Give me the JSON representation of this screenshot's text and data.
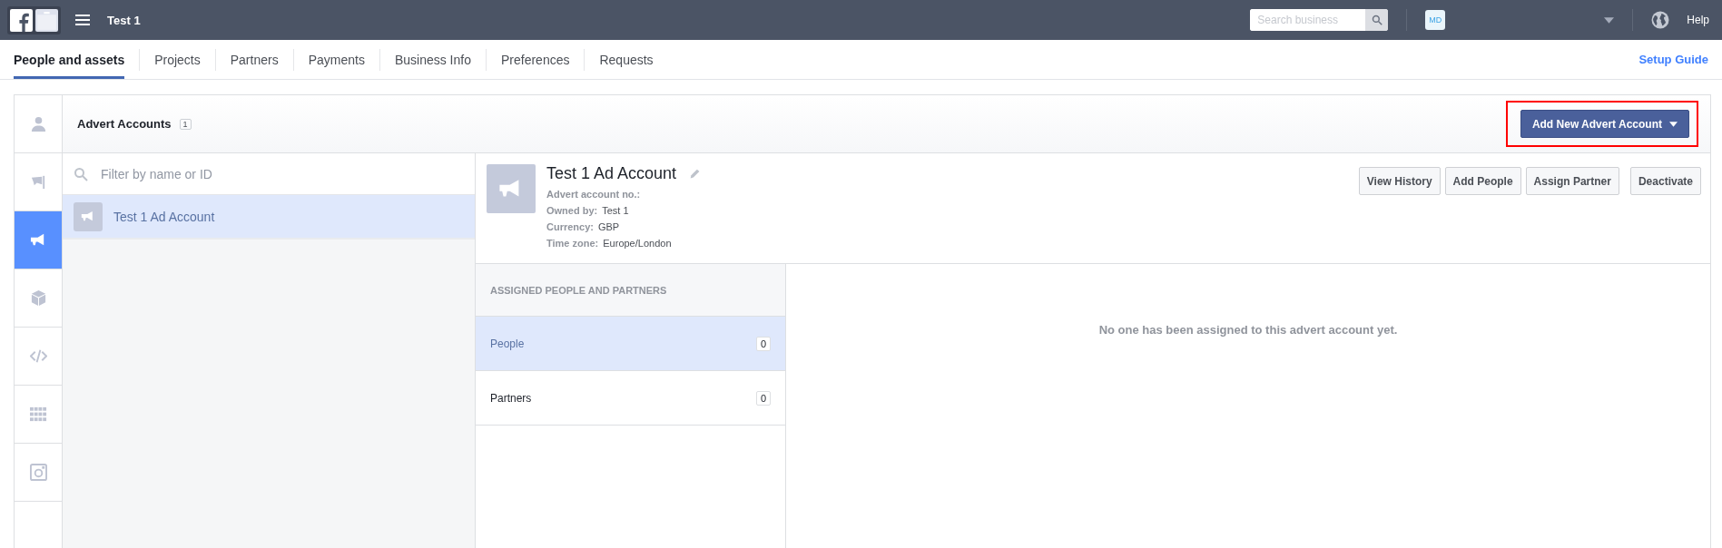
{
  "topbar": {
    "title": "Test 1",
    "search_placeholder": "Search business",
    "avatar": "MD",
    "help": "Help"
  },
  "tabs": [
    {
      "label": "People and assets",
      "selected": true
    },
    {
      "label": "Projects",
      "selected": false
    },
    {
      "label": "Partners",
      "selected": false
    },
    {
      "label": "Payments",
      "selected": false
    },
    {
      "label": "Business Info",
      "selected": false
    },
    {
      "label": "Preferences",
      "selected": false
    },
    {
      "label": "Requests",
      "selected": false
    }
  ],
  "setup_guide": "Setup Guide",
  "rail": [
    {
      "kind": "person",
      "selected": false
    },
    {
      "kind": "flag",
      "selected": false
    },
    {
      "kind": "megaphone",
      "selected": true
    },
    {
      "kind": "cube",
      "selected": false
    },
    {
      "kind": "code",
      "selected": false
    },
    {
      "kind": "grid",
      "selected": false
    },
    {
      "kind": "camera",
      "selected": false
    }
  ],
  "section": {
    "title": "Advert Accounts",
    "count": "1",
    "add_button": "Add New Advert Account",
    "highlighted": true
  },
  "filter_placeholder": "Filter by name or ID",
  "accounts": [
    {
      "name": "Test 1 Ad Account",
      "selected": true
    }
  ],
  "detail": {
    "name": "Test 1 Ad Account",
    "fields": [
      {
        "label": "Advert account no.:"
      },
      {
        "label": "Owned by:",
        "value": "Test 1"
      },
      {
        "label": "Currency:",
        "value": "GBP"
      },
      {
        "label": "Time zone:",
        "value": "Europe/London"
      }
    ],
    "buttons": [
      "View History",
      "Add People",
      "Assign Partner",
      "Deactivate"
    ]
  },
  "assigned": {
    "heading": "ASSIGNED PEOPLE AND PARTNERS",
    "items": [
      {
        "label": "People",
        "count": "0",
        "selected": true
      },
      {
        "label": "Partners",
        "count": "0",
        "selected": false
      }
    ],
    "empty_message": "No one has been assigned to this advert account yet."
  }
}
